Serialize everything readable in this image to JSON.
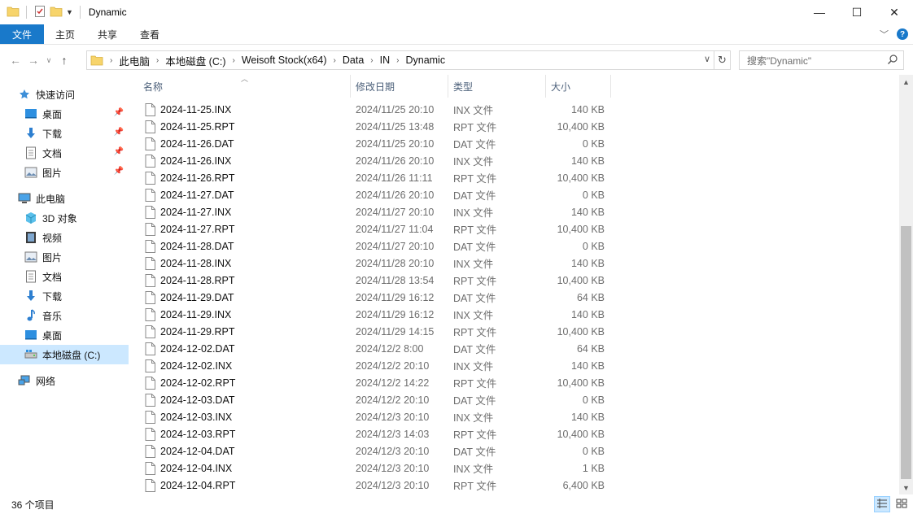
{
  "window": {
    "title": "Dynamic",
    "minimize": "—",
    "maximize": "☐",
    "close": "✕"
  },
  "ribbon": {
    "tabs": [
      "文件",
      "主页",
      "共享",
      "查看"
    ]
  },
  "address": {
    "crumbs": [
      "此电脑",
      "本地磁盘 (C:)",
      "Weisoft Stock(x64)",
      "Data",
      "IN",
      "Dynamic"
    ],
    "search_placeholder": "搜索\"Dynamic\""
  },
  "navpane": {
    "quick_access": "快速访问",
    "quick_items": [
      "桌面",
      "下载",
      "文档",
      "图片"
    ],
    "this_pc": "此电脑",
    "pc_items": [
      "3D 对象",
      "视频",
      "图片",
      "文档",
      "下载",
      "音乐",
      "桌面",
      "本地磁盘 (C:)"
    ],
    "network": "网络"
  },
  "columns": {
    "name": "名称",
    "date": "修改日期",
    "type": "类型",
    "size": "大小"
  },
  "files": [
    {
      "name": "2024-11-25.INX",
      "date": "2024/11/25 20:10",
      "type": "INX 文件",
      "size": "140 KB"
    },
    {
      "name": "2024-11-25.RPT",
      "date": "2024/11/25 13:48",
      "type": "RPT 文件",
      "size": "10,400 KB"
    },
    {
      "name": "2024-11-26.DAT",
      "date": "2024/11/25 20:10",
      "type": "DAT 文件",
      "size": "0 KB"
    },
    {
      "name": "2024-11-26.INX",
      "date": "2024/11/26 20:10",
      "type": "INX 文件",
      "size": "140 KB"
    },
    {
      "name": "2024-11-26.RPT",
      "date": "2024/11/26 11:11",
      "type": "RPT 文件",
      "size": "10,400 KB"
    },
    {
      "name": "2024-11-27.DAT",
      "date": "2024/11/26 20:10",
      "type": "DAT 文件",
      "size": "0 KB"
    },
    {
      "name": "2024-11-27.INX",
      "date": "2024/11/27 20:10",
      "type": "INX 文件",
      "size": "140 KB"
    },
    {
      "name": "2024-11-27.RPT",
      "date": "2024/11/27 11:04",
      "type": "RPT 文件",
      "size": "10,400 KB"
    },
    {
      "name": "2024-11-28.DAT",
      "date": "2024/11/27 20:10",
      "type": "DAT 文件",
      "size": "0 KB"
    },
    {
      "name": "2024-11-28.INX",
      "date": "2024/11/28 20:10",
      "type": "INX 文件",
      "size": "140 KB"
    },
    {
      "name": "2024-11-28.RPT",
      "date": "2024/11/28 13:54",
      "type": "RPT 文件",
      "size": "10,400 KB"
    },
    {
      "name": "2024-11-29.DAT",
      "date": "2024/11/29 16:12",
      "type": "DAT 文件",
      "size": "64 KB"
    },
    {
      "name": "2024-11-29.INX",
      "date": "2024/11/29 16:12",
      "type": "INX 文件",
      "size": "140 KB"
    },
    {
      "name": "2024-11-29.RPT",
      "date": "2024/11/29 14:15",
      "type": "RPT 文件",
      "size": "10,400 KB"
    },
    {
      "name": "2024-12-02.DAT",
      "date": "2024/12/2 8:00",
      "type": "DAT 文件",
      "size": "64 KB"
    },
    {
      "name": "2024-12-02.INX",
      "date": "2024/12/2 20:10",
      "type": "INX 文件",
      "size": "140 KB"
    },
    {
      "name": "2024-12-02.RPT",
      "date": "2024/12/2 14:22",
      "type": "RPT 文件",
      "size": "10,400 KB"
    },
    {
      "name": "2024-12-03.DAT",
      "date": "2024/12/2 20:10",
      "type": "DAT 文件",
      "size": "0 KB"
    },
    {
      "name": "2024-12-03.INX",
      "date": "2024/12/3 20:10",
      "type": "INX 文件",
      "size": "140 KB"
    },
    {
      "name": "2024-12-03.RPT",
      "date": "2024/12/3 14:03",
      "type": "RPT 文件",
      "size": "10,400 KB"
    },
    {
      "name": "2024-12-04.DAT",
      "date": "2024/12/3 20:10",
      "type": "DAT 文件",
      "size": "0 KB"
    },
    {
      "name": "2024-12-04.INX",
      "date": "2024/12/3 20:10",
      "type": "INX 文件",
      "size": "1 KB"
    },
    {
      "name": "2024-12-04.RPT",
      "date": "2024/12/3 20:10",
      "type": "RPT 文件",
      "size": "6,400 KB"
    }
  ],
  "status": {
    "item_count": "36 个项目"
  },
  "colors": {
    "accent": "#1979ca",
    "selected_bg": "#cce8ff",
    "header_text": "#4c607a",
    "secondary_text": "#6d6d6d"
  }
}
